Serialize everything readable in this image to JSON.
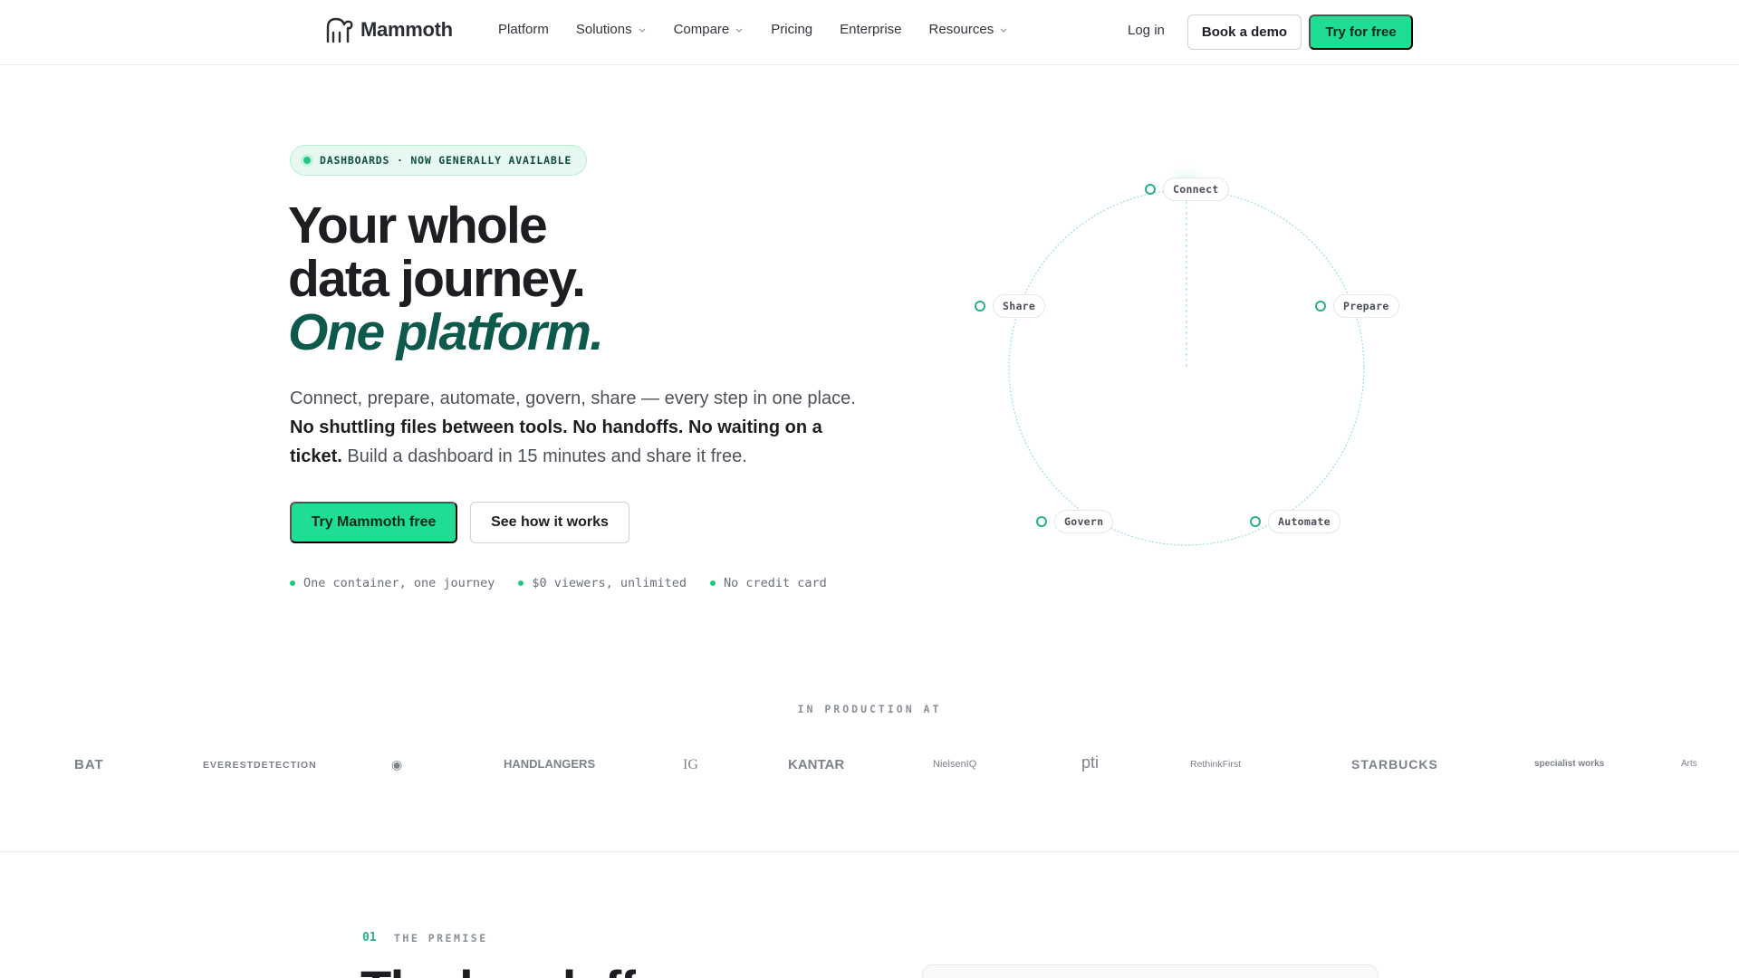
{
  "nav": {
    "logo_text": "Mammoth",
    "links": [
      {
        "label": "Platform",
        "has_dropdown": false
      },
      {
        "label": "Solutions",
        "has_dropdown": true
      },
      {
        "label": "Compare",
        "has_dropdown": true
      },
      {
        "label": "Pricing",
        "has_dropdown": false
      },
      {
        "label": "Enterprise",
        "has_dropdown": false
      },
      {
        "label": "Resources",
        "has_dropdown": true
      }
    ],
    "login_label": "Log in",
    "demo_label": "Book a demo",
    "try_label": "Try for free"
  },
  "hero": {
    "badge": "DASHBOARDS · NOW GENERALLY AVAILABLE",
    "headline_line1": "Your whole",
    "headline_line2": "data journey.",
    "headline_accent": "One platform.",
    "lede_part1": "Connect, prepare, automate, govern, share — every step in one place. ",
    "lede_bold": "No shuttling files between tools. No handoffs. No waiting on a ticket.",
    "lede_part2": " Build a dashboard in 15 minutes and share it free.",
    "cta_primary": "Try Mammoth free",
    "cta_secondary": "See how it works",
    "checks": [
      "One container, one journey",
      "$0 viewers, unlimited",
      "No credit card"
    ]
  },
  "diagram": {
    "nodes": [
      "Connect",
      "Prepare",
      "Automate",
      "Govern",
      "Share"
    ]
  },
  "customers": {
    "label": "IN PRODUCTION AT",
    "logos": [
      "BAT",
      "EVERESTDETECTION",
      "HANDLANGERS",
      "IG",
      "KANTAR",
      "NielsenIQ",
      "pti",
      "RethinkFirst",
      "STARBUCKS",
      "specialist works",
      "Arts"
    ]
  },
  "premise": {
    "number": "01",
    "label": "THE PREMISE",
    "title": "The handoff"
  },
  "colors": {
    "accent_green": "#1fde93",
    "accent_dark": "#0d5a4c",
    "ring_teal": "#28b08e"
  }
}
